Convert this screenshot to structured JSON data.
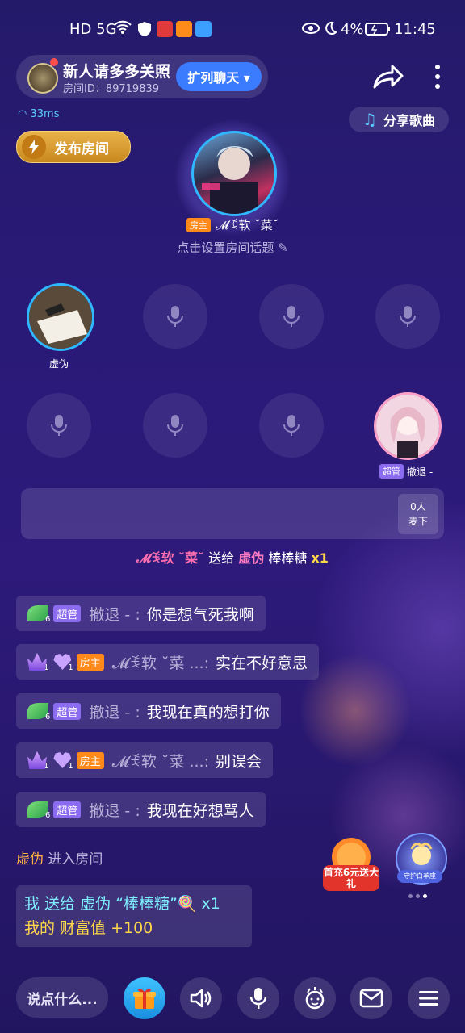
{
  "status_bar": {
    "left": "HD 5G",
    "battery": "4%",
    "time": "11:45"
  },
  "header": {
    "room_title": "新人请多多关照",
    "room_id": "房间ID：89719839",
    "expand_button": "扩列聊天 ▾",
    "ping": "33ms",
    "share_song": "分享歌曲",
    "publish_room": "发布房间"
  },
  "host": {
    "tag": "房主",
    "name": "𝓜ꉂ软 ˘菜˘ ",
    "topic": "点击设置房间话题"
  },
  "seats": {
    "seat1_name": "虚伪",
    "seat8_tag": "超管",
    "seat8_name": "撤退 -"
  },
  "board": {
    "count": "0人",
    "label": "麦下"
  },
  "gift_broadcast": {
    "sender": "𝓜ꉂ软 ˘菜˘",
    "verb": "送给",
    "receiver": "虚伪",
    "gift": "棒棒糖",
    "qty": "x1"
  },
  "chat": [
    {
      "badges": "6",
      "tag": "超管",
      "name": "撤退 - :",
      "message": "你是想气死我啊"
    },
    {
      "badges": "1",
      "tag": "房主",
      "name": "𝓜ꉂ软 ˘菜 ...:",
      "message": "实在不好意思"
    },
    {
      "badges": "6",
      "tag": "超管",
      "name": "撤退 - :",
      "message": "我现在真的想打你"
    },
    {
      "badges": "1",
      "tag": "房主",
      "name": "𝓜ꉂ软 ˘菜 ...:",
      "message": "别误会"
    },
    {
      "badges": "6",
      "tag": "超管",
      "name": "撤退 - :",
      "message": "我现在好想骂人"
    }
  ],
  "enter": {
    "who": "虚伪",
    "text": "进入房间"
  },
  "my_gift": {
    "line1": "我 送给 虚伪 “棒棒糖”🍭 x1",
    "line2": "我的 财富值 +100"
  },
  "promo": {
    "first_recharge": "首充6元送大礼",
    "guard": "守护白羊座"
  },
  "bottom": {
    "input_placeholder": "说点什么..."
  }
}
